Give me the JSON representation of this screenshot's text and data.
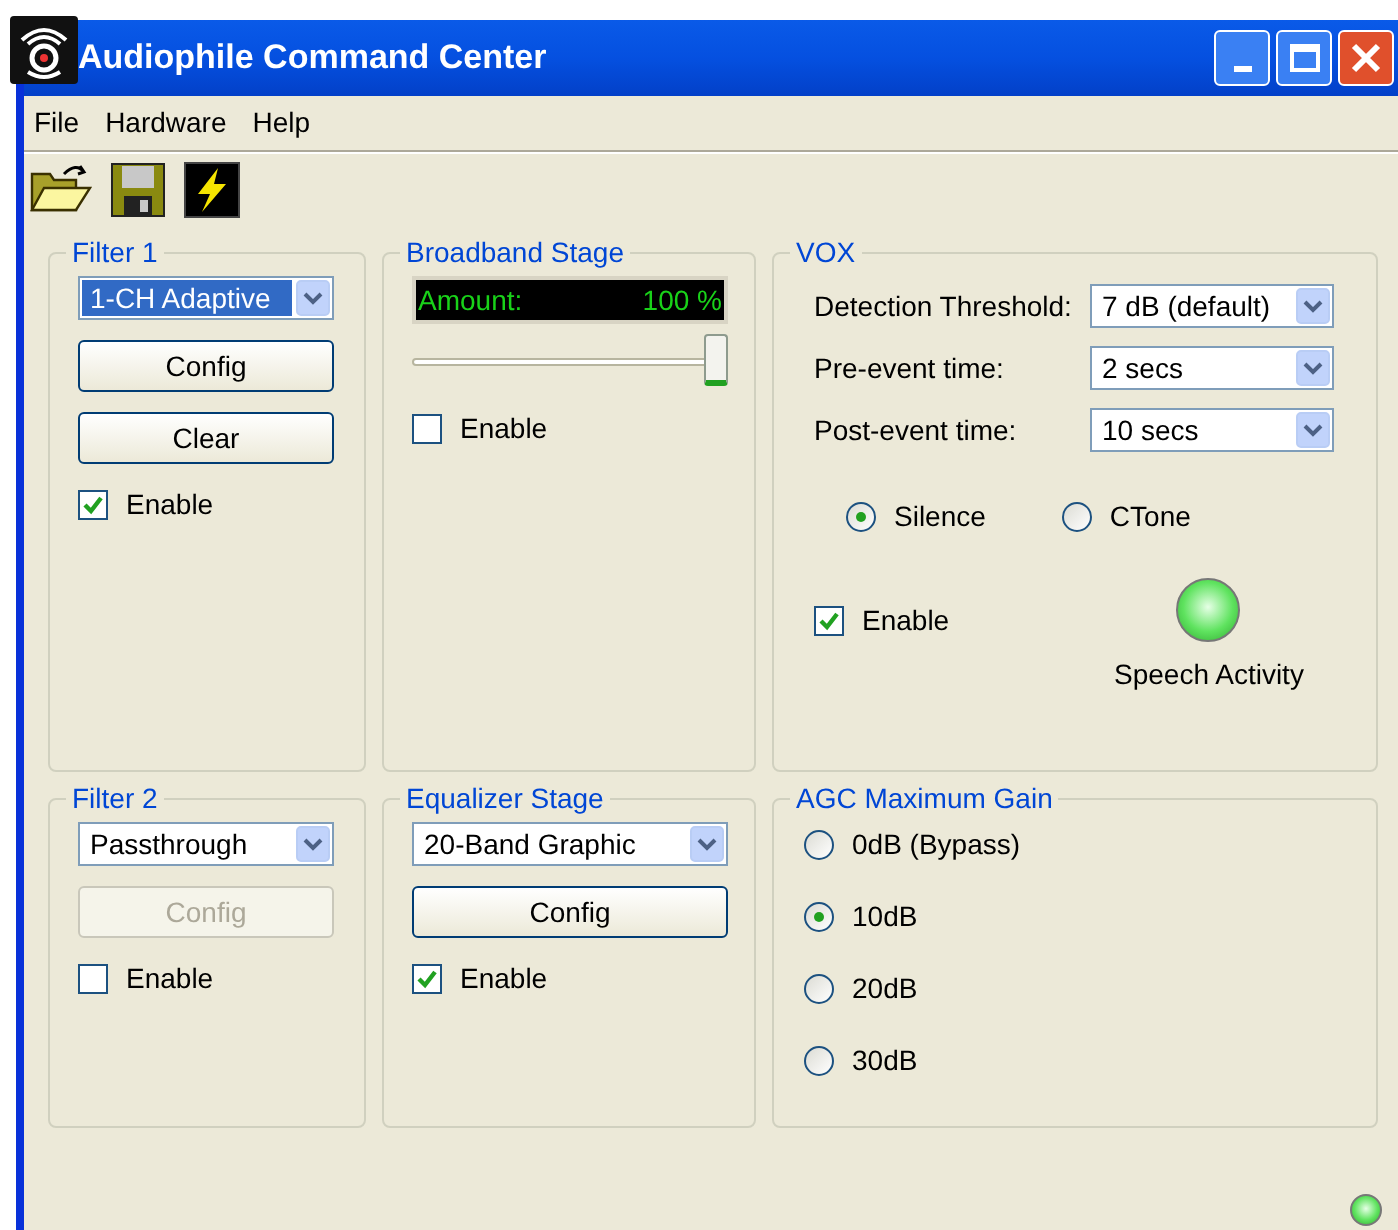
{
  "window": {
    "title": "Audiophile Command Center"
  },
  "menu": [
    {
      "label": "File"
    },
    {
      "label": "Hardware"
    },
    {
      "label": "Help"
    }
  ],
  "toolbar": [
    {
      "kind": "open"
    },
    {
      "kind": "save"
    },
    {
      "kind": "power"
    }
  ],
  "filter_1": {
    "title": "Filter 1",
    "dropdown": {
      "value": "1-CH Adaptive",
      "focused": true
    },
    "buttons": [
      {
        "label": "Config",
        "disabled": false
      },
      {
        "label": "Clear",
        "disabled": false
      }
    ],
    "enable": {
      "label": "Enable",
      "checked": true
    }
  },
  "broadband_stage": {
    "title": "Broadband Stage",
    "display": {
      "label": "Amount:",
      "reading": "100 %"
    },
    "slider": {
      "level": 1
    },
    "enable": {
      "label": "Enable",
      "checked": false
    }
  },
  "vox": {
    "title": "VOX",
    "fields": [
      {
        "label": "Detection Threshold:",
        "value": "7 dB (default)"
      },
      {
        "label": "Pre-event time:",
        "value": "2 secs"
      },
      {
        "label": "Post-event time:",
        "value": "10 secs"
      }
    ],
    "modes": [
      {
        "label": "Silence",
        "selected": true
      },
      {
        "label": "CTone",
        "selected": false
      }
    ],
    "enable": {
      "label": "Enable",
      "checked": true
    },
    "indicator": {
      "label": "Speech Activity",
      "on": true
    }
  },
  "filter_2": {
    "title": "Filter 2",
    "dropdown": {
      "value": "Passthrough",
      "focused": false
    },
    "buttons": [
      {
        "label": "Config",
        "disabled": true
      }
    ],
    "enable": {
      "label": "Enable",
      "checked": false
    }
  },
  "equalizer_stage": {
    "title": "Equalizer Stage",
    "dropdown": {
      "value": "20-Band Graphic",
      "focused": false
    },
    "buttons": [
      {
        "label": "Config",
        "disabled": false
      }
    ],
    "enable": {
      "label": "Enable",
      "checked": true
    }
  },
  "agc": {
    "title": "AGC Maximum Gain",
    "options": [
      {
        "label": "0dB (Bypass)",
        "selected": false
      },
      {
        "label": "10dB",
        "selected": true
      },
      {
        "label": "20dB",
        "selected": false
      },
      {
        "label": "30dB",
        "selected": false
      }
    ]
  },
  "status_bar": {
    "indicator_on": true
  }
}
